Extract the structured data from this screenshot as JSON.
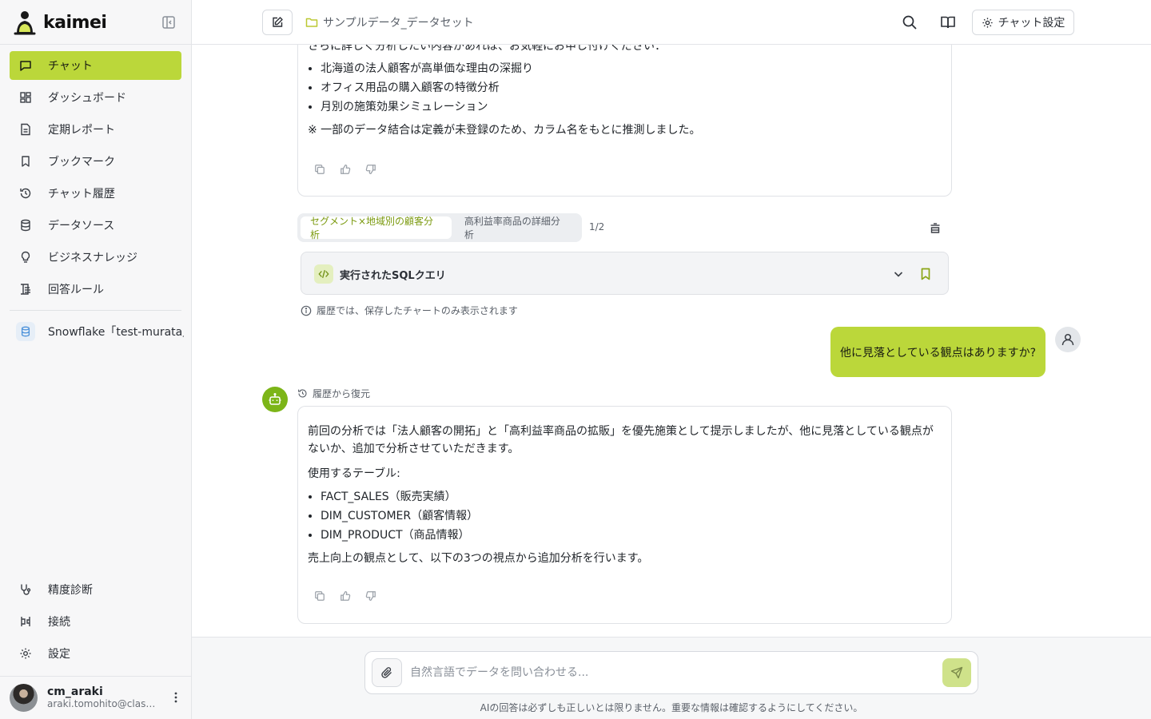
{
  "app": {
    "name": "kaimei"
  },
  "sidebar": {
    "items": [
      {
        "label": "チャット",
        "icon": "chat-icon",
        "active": true
      },
      {
        "label": "ダッシュボード",
        "icon": "dashboard-icon",
        "active": false
      },
      {
        "label": "定期レポート",
        "icon": "report-icon",
        "active": false
      },
      {
        "label": "ブックマーク",
        "icon": "bookmark-icon",
        "active": false
      },
      {
        "label": "チャット履歴",
        "icon": "history-icon",
        "active": false
      },
      {
        "label": "データソース",
        "icon": "database-icon",
        "active": false
      },
      {
        "label": "ビジネスナレッジ",
        "icon": "lightbulb-icon",
        "active": false
      },
      {
        "label": "回答ルール",
        "icon": "rules-icon",
        "active": false
      }
    ],
    "datasource": "Snowflake「test-murata」",
    "bottom_items": [
      {
        "label": "精度診断",
        "icon": "stethoscope-icon"
      },
      {
        "label": "接続",
        "icon": "connection-icon"
      },
      {
        "label": "設定",
        "icon": "gear-icon"
      }
    ],
    "user": {
      "name": "cm_araki",
      "email": "araki.tomohito@class..."
    }
  },
  "header": {
    "dataset": "サンプルデータ_データセット",
    "chat_settings_label": "チャット設定"
  },
  "conversation": {
    "first_answer": {
      "intro": "さらに詳しく分析したい内容があれば、お気軽にお申し付けください：",
      "bullets": [
        "北海道の法人顧客が高単価な理由の深掘り",
        "オフィス用品の購入顧客の特徴分析",
        "月別の施策効果シミュレーション"
      ],
      "note": "※ 一部のデータ結合は定義が未登録のため、カラム名をもとに推測しました。"
    },
    "tabs": [
      {
        "label": "セグメント×地域別の顧客分析",
        "active": true
      },
      {
        "label": "高利益率商品の詳細分析",
        "active": false
      }
    ],
    "tab_counter": "1/2",
    "sql_label": "実行されたSQLクエリ",
    "history_note": "履歴では、保存したチャートのみ表示されます",
    "user_message": "他に見落としている観点はありますか?",
    "restore_label": "履歴から復元",
    "second_answer": {
      "p1": "前回の分析では「法人顧客の開拓」と「高利益率商品の拡販」を優先施策として提示しましたが、他に見落としている観点がないか、追加で分析させていただきます。",
      "p2": "使用するテーブル:",
      "bullets": [
        "FACT_SALES（販売実績）",
        "DIM_CUSTOMER（顧客情報）",
        "DIM_PRODUCT（商品情報）"
      ],
      "p3": "売上向上の観点として、以下の3つの視点から追加分析を行います。"
    }
  },
  "composer": {
    "placeholder": "自然言語でデータを問い合わせる...",
    "value": "",
    "disclaimer": "AIの回答は必ずしも正しいとは限りません。重要な情報は確認するようにしてください。"
  },
  "colors": {
    "accent": "#bbd73a",
    "accent_text": "#7b9a0f",
    "bot_avatar": "#7cb518"
  }
}
